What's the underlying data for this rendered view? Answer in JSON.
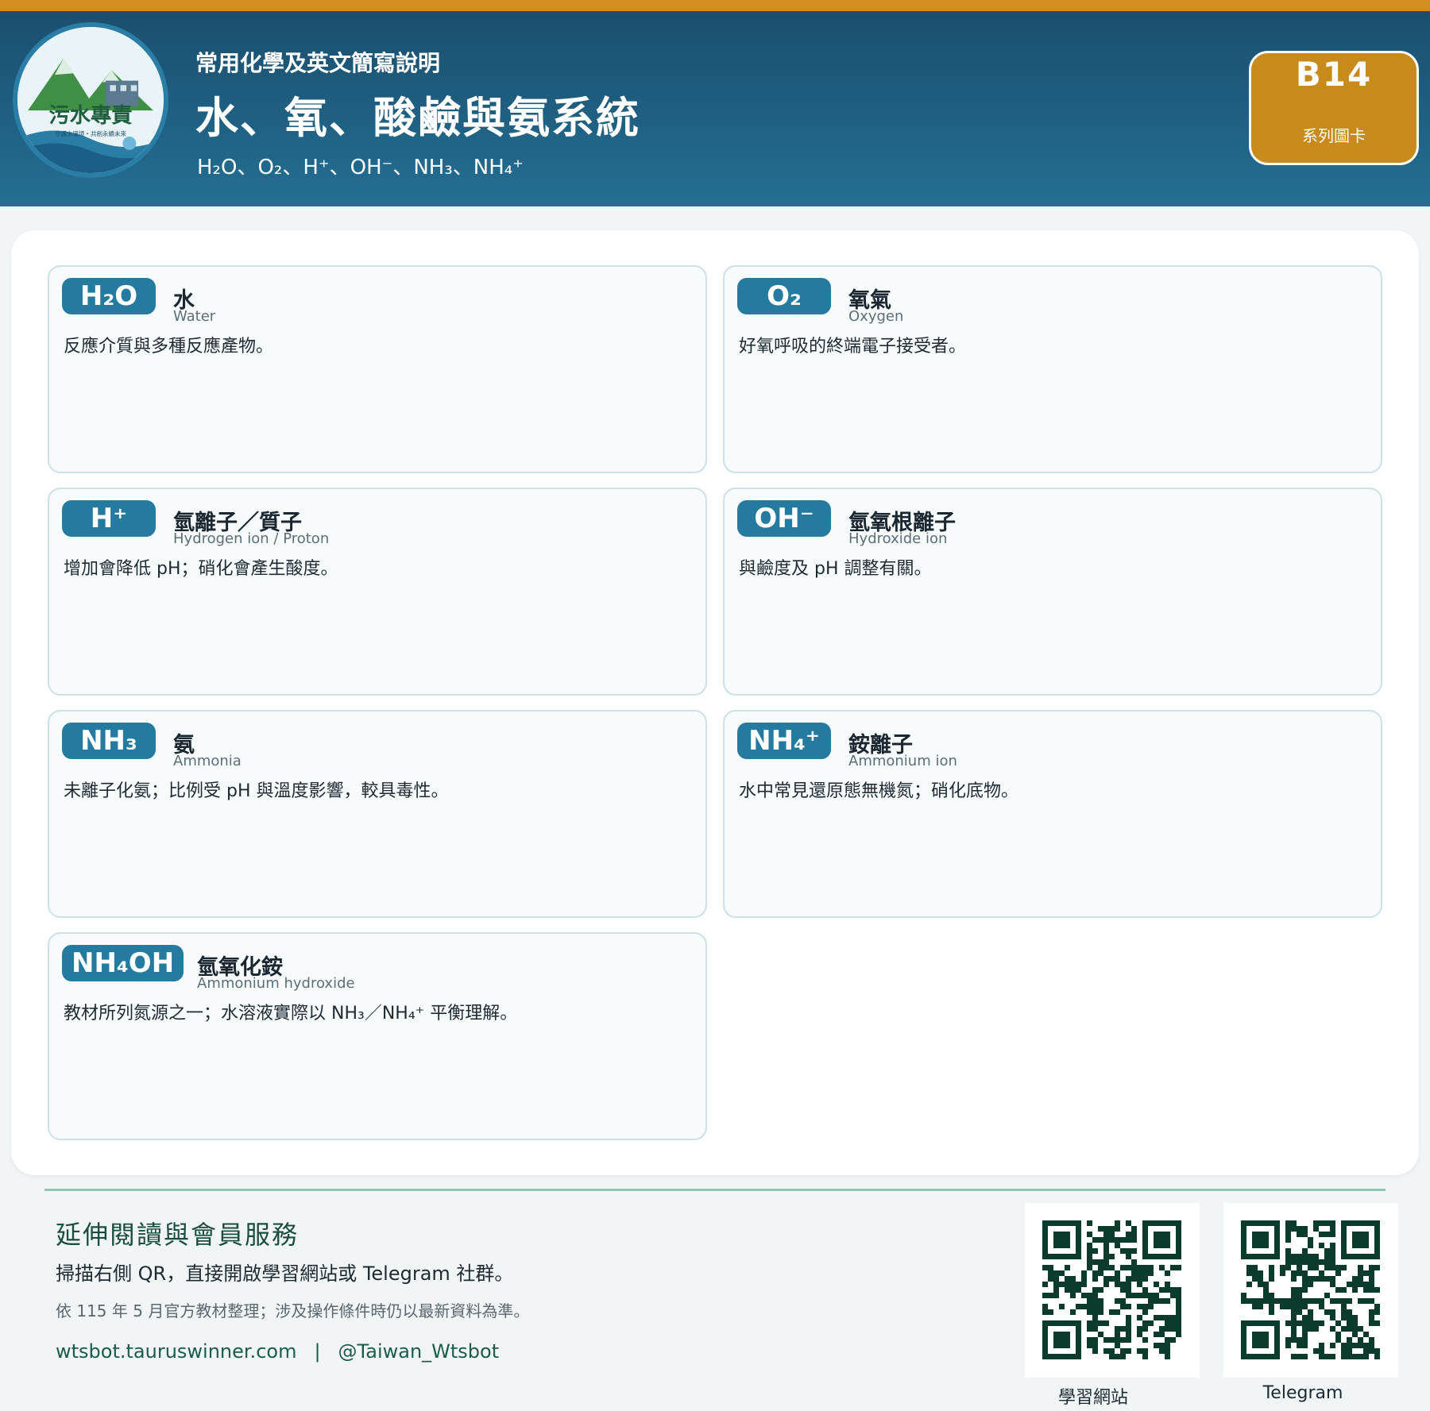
{
  "colors": {
    "accent": "#d48f1f",
    "header_dark": "#1b4e6e",
    "header_light": "#236f93",
    "pill": "#257aa0",
    "badge": "#c98a1c",
    "footer_green": "#1b4d3e"
  },
  "logo": {
    "text": "污水專責",
    "tagline": "守護水環境・共創永續未來",
    "icon": "mountain-water-logo-icon"
  },
  "header": {
    "subtitle": "常用化學及英文簡寫說明",
    "title": "水、氧、酸鹼與氨系統",
    "formula_line": "H₂O、O₂、H⁺、OH⁻、NH₃、NH₄⁺"
  },
  "badge": {
    "code": "B14",
    "label": "系列圖卡"
  },
  "cards": [
    {
      "symbol": "H₂O",
      "zh": "水",
      "en": "Water",
      "desc": "反應介質與多種反應產物。"
    },
    {
      "symbol": "O₂",
      "zh": "氧氣",
      "en": "Oxygen",
      "desc": "好氧呼吸的終端電子接受者。"
    },
    {
      "symbol": "H⁺",
      "zh": "氫離子／質子",
      "en": "Hydrogen ion / Proton",
      "desc": "增加會降低 pH；硝化會產生酸度。"
    },
    {
      "symbol": "OH⁻",
      "zh": "氫氧根離子",
      "en": "Hydroxide ion",
      "desc": "與鹼度及 pH 調整有關。"
    },
    {
      "symbol": "NH₃",
      "zh": "氨",
      "en": "Ammonia",
      "desc": "未離子化氨；比例受 pH 與溫度影響，較具毒性。"
    },
    {
      "symbol": "NH₄⁺",
      "zh": "銨離子",
      "en": "Ammonium ion",
      "desc": "水中常見還原態無機氮；硝化底物。"
    },
    {
      "symbol": "NH₄OH",
      "zh": "氫氧化銨",
      "en": "Ammonium hydroxide",
      "desc": "教材所列氮源之一；水溶液實際以 NH₃／NH₄⁺ 平衡理解。"
    }
  ],
  "footer": {
    "title": "延伸閱讀與會員服務",
    "line": "掃描右側 QR，直接開啟學習網站或 Telegram 社群。",
    "note": "依 115 年 5 月官方教材整理；涉及操作條件時仍以最新資料為準。",
    "website": "wtsbot.tauruswinner.com",
    "separator": "|",
    "telegram_handle": "@Taiwan_Wtsbot"
  },
  "qr_codes": [
    {
      "caption": "學習網站",
      "icon": "qr-code-icon"
    },
    {
      "caption": "Telegram",
      "icon": "qr-code-icon"
    }
  ]
}
